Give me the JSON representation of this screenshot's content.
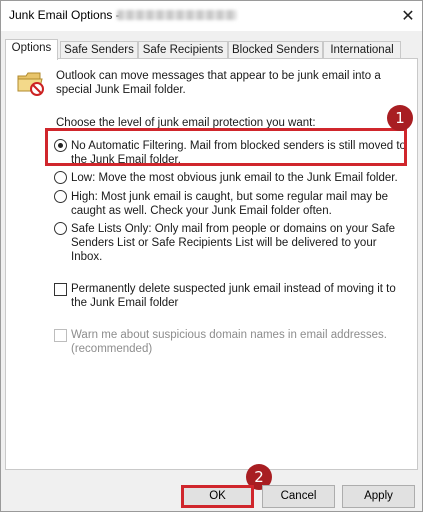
{
  "window": {
    "title": "Junk Email Options -",
    "close_glyph": "✕"
  },
  "tabs": [
    {
      "label": "Options",
      "active": true
    },
    {
      "label": "Safe Senders",
      "active": false
    },
    {
      "label": "Safe Recipients",
      "active": false
    },
    {
      "label": "Blocked Senders",
      "active": false
    },
    {
      "label": "International",
      "active": false
    }
  ],
  "options_panel": {
    "icon": "junk-folder-icon",
    "intro_text": "Outlook can move messages that appear to be junk email into a special Junk Email folder.",
    "choose_label": "Choose the level of junk email protection you want:",
    "levels": [
      {
        "label": "No Automatic Filtering. Mail from blocked senders is still moved to the Junk Email folder.",
        "selected": true
      },
      {
        "label": "Low: Move the most obvious junk email to the Junk Email folder.",
        "selected": false
      },
      {
        "label": "High: Most junk email is caught, but some regular mail may be caught as well. Check your Junk Email folder often.",
        "selected": false
      },
      {
        "label": "Safe Lists Only: Only mail from people or domains on your Safe Senders List or Safe Recipients List will be delivered to your Inbox.",
        "selected": false
      }
    ],
    "permanently_delete": {
      "label": "Permanently delete suspected junk email instead of moving it to the Junk Email folder",
      "checked": false
    },
    "warn_suspicious": {
      "label": "Warn me about suspicious domain names in email addresses. (recommended)",
      "checked": false,
      "disabled": true
    }
  },
  "annotations": {
    "step1": "1",
    "step2": "2",
    "highlight_color": "#d0262c",
    "badge_color": "#a81e22"
  },
  "buttons": {
    "ok": "OK",
    "cancel": "Cancel",
    "apply": "Apply"
  }
}
